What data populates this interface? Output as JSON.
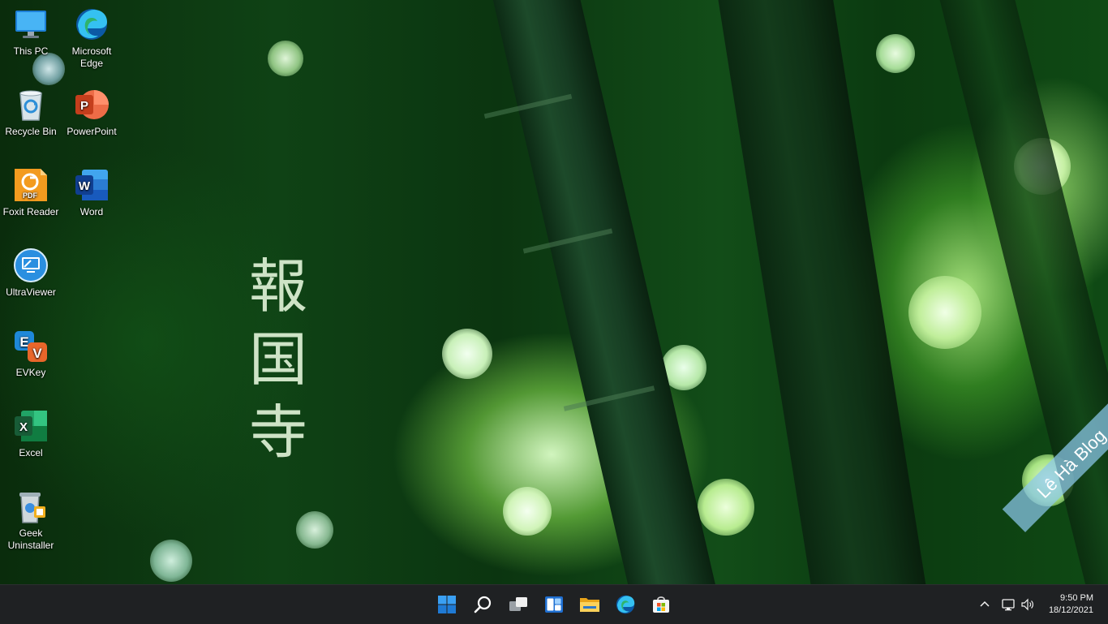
{
  "wallpaper": {
    "calligraphy": [
      "報",
      "国",
      "寺"
    ]
  },
  "desktop_icons": [
    {
      "id": "this-pc",
      "label": "This PC",
      "icon": "monitor-icon"
    },
    {
      "id": "microsoft-edge",
      "label": "Microsoft Edge",
      "icon": "edge-icon"
    },
    {
      "id": "recycle-bin",
      "label": "Recycle Bin",
      "icon": "recycle-bin-icon"
    },
    {
      "id": "powerpoint",
      "label": "PowerPoint",
      "icon": "powerpoint-icon"
    },
    {
      "id": "foxit-reader",
      "label": "Foxit Reader",
      "icon": "foxit-pdf-icon"
    },
    {
      "id": "word",
      "label": "Word",
      "icon": "word-icon"
    },
    {
      "id": "ultraviewer",
      "label": "UltraViewer",
      "icon": "ultraviewer-icon"
    },
    {
      "id": "evkey",
      "label": "EVKey",
      "icon": "evkey-icon"
    },
    {
      "id": "excel",
      "label": "Excel",
      "icon": "excel-icon"
    },
    {
      "id": "geek-uninstaller",
      "label": "Geek Uninstaller",
      "icon": "geek-uninstaller-icon"
    }
  ],
  "taskbar": {
    "apps": [
      {
        "name": "Start",
        "icon": "windows-start-icon"
      },
      {
        "name": "Search",
        "icon": "search-icon"
      },
      {
        "name": "Task View",
        "icon": "task-view-icon"
      },
      {
        "name": "Widgets",
        "icon": "widgets-icon"
      },
      {
        "name": "File Explorer",
        "icon": "folder-icon"
      },
      {
        "name": "Microsoft Edge",
        "icon": "edge-icon"
      },
      {
        "name": "Microsoft Store",
        "icon": "store-icon"
      }
    ],
    "tray": {
      "chevron_icon": "chevron-up-icon",
      "network_icon": "network-icon",
      "volume_icon": "volume-icon",
      "time": "9:50 PM",
      "date": "18/12/2021"
    }
  },
  "watermark": {
    "text": "Lê Hà Blog"
  },
  "colors": {
    "taskbar_bg": "#1f2123",
    "accent_blue": "#2a8fe0",
    "wallpaper_green": "#0f4215"
  }
}
